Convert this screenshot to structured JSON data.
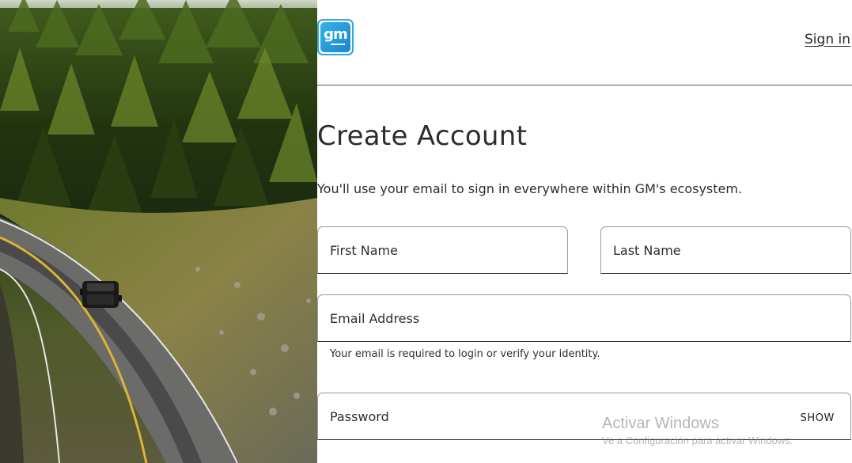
{
  "header": {
    "logo_text": "gm",
    "signin_label": "Sign in"
  },
  "main": {
    "title": "Create Account",
    "subtitle": "You'll use your email to sign in everywhere within GM's ecosystem."
  },
  "form": {
    "first_name": {
      "placeholder": "First Name",
      "value": ""
    },
    "last_name": {
      "placeholder": "Last Name",
      "value": ""
    },
    "email": {
      "placeholder": "Email Address",
      "value": "",
      "helper": "Your email is required to login or verify your identity."
    },
    "password": {
      "placeholder": "Password",
      "value": "",
      "toggle_label": "SHOW"
    }
  },
  "watermark": {
    "line1": "Activar Windows",
    "line2": "Ve a Configuración para activar Windows."
  },
  "colors": {
    "brand": "#2ea6e0",
    "text": "#2d2d2d",
    "border": "#9a9a9a"
  },
  "icons": {
    "logo": "gm-logo-icon"
  }
}
